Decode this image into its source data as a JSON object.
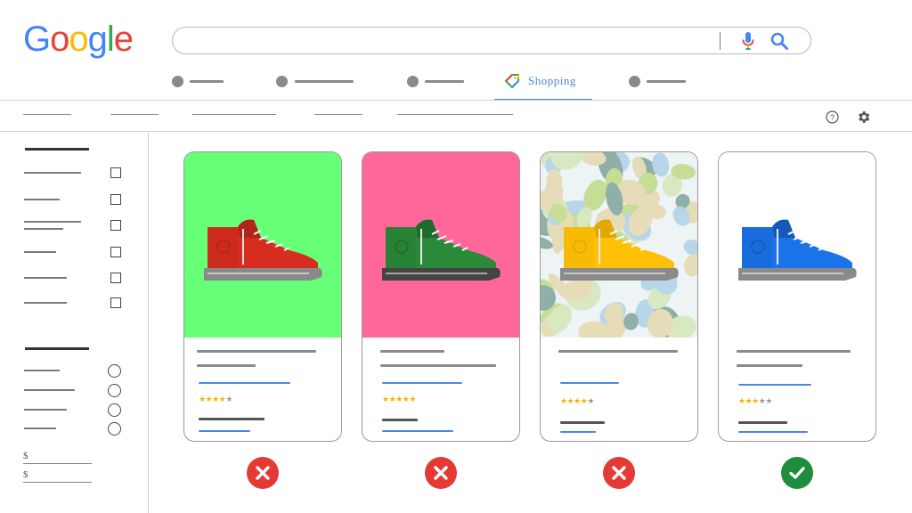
{
  "logo": {
    "letters": [
      "G",
      "o",
      "o",
      "g",
      "l",
      "e"
    ],
    "colors": [
      "#4285f4",
      "#ea4335",
      "#fbbc05",
      "#4285f4",
      "#34a853",
      "#ea4335"
    ]
  },
  "search": {
    "value": "",
    "mic_icon": "mic-icon",
    "search_icon": "search-icon"
  },
  "tabs": {
    "active_label": "Shopping",
    "active_icon": "tag-icon"
  },
  "toolbar": {
    "help_icon": "help-icon",
    "settings_icon": "gear-icon"
  },
  "sidebar": {
    "price_from_symbol": "$",
    "price_to_symbol": "$"
  },
  "products": [
    {
      "bg": "#66ff77",
      "shoe_color": "#d62d20",
      "shoe_dark": "#b22318",
      "sole": "#8a8a8a",
      "pattern": false,
      "stars": 4,
      "status": "rejected"
    },
    {
      "bg": "#ff6699",
      "shoe_color": "#2a8a3a",
      "shoe_dark": "#1f6b2c",
      "sole": "#444444",
      "pattern": false,
      "stars": 5,
      "status": "rejected"
    },
    {
      "bg": "#eef3f5",
      "shoe_color": "#ffc107",
      "shoe_dark": "#e0a800",
      "sole": "#8a8a8a",
      "pattern": true,
      "stars": 4,
      "status": "rejected"
    },
    {
      "bg": "#ffffff",
      "shoe_color": "#1a73e8",
      "shoe_dark": "#1558b8",
      "sole": "#8a8a8a",
      "pattern": false,
      "stars": 3,
      "status": "approved"
    }
  ],
  "colors": {
    "accent_blue": "#4a86e8",
    "reject_red": "#e53935",
    "approve_green": "#1e8e3e",
    "star_yellow": "#f4b400"
  }
}
